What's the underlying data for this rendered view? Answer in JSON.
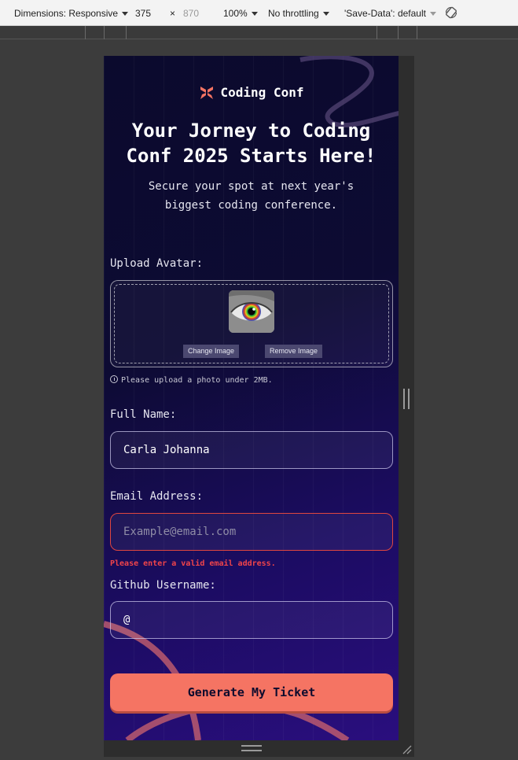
{
  "devtools": {
    "dimensions_label": "Dimensions: Responsive",
    "width": "375",
    "times": "×",
    "height": "870",
    "zoom": "100%",
    "throttling": "No throttling",
    "save_data": "'Save-Data': default"
  },
  "app": {
    "logo_text": "Coding Conf",
    "title": "Your Jorney to Coding Conf 2025 Starts Here!",
    "subtitle": "Secure your spot at next year's biggest coding conference.",
    "avatar": {
      "label": "Upload Avatar:",
      "change_button": "Change Image",
      "remove_button": "Remove Image",
      "hint": "Please upload a photo under 2MB."
    },
    "full_name": {
      "label": "Full Name:",
      "value": "Carla Johanna"
    },
    "email": {
      "label": "Email Address:",
      "placeholder": "Example@email.com",
      "value": "",
      "error": "Please enter a valid email address."
    },
    "github": {
      "label": "Github Username:",
      "value": "@"
    },
    "submit_label": "Generate My Ticket",
    "colors": {
      "accent": "#f57463",
      "error": "#f0444a",
      "background": "#0d0b33"
    }
  }
}
